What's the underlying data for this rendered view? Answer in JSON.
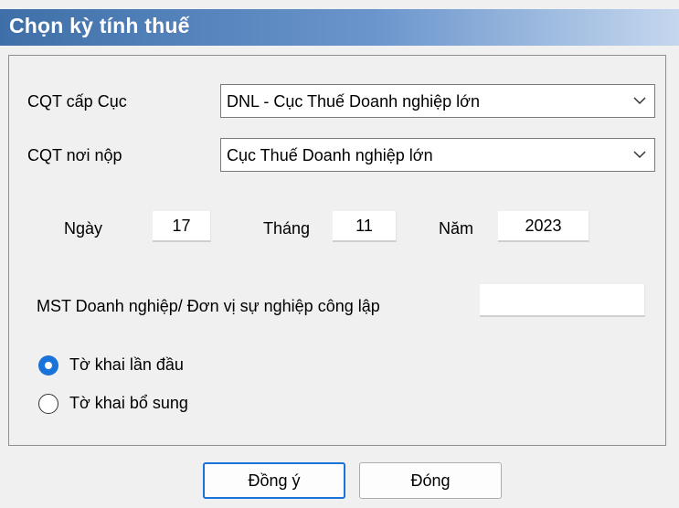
{
  "window": {
    "title": "Chọn kỳ tính thuế"
  },
  "form": {
    "cqt_cap_cuc": {
      "label": "CQT cấp Cục",
      "value": "DNL - Cục Thuế Doanh nghiệp lớn"
    },
    "cqt_noi_nop": {
      "label": "CQT nơi nộp",
      "value": "Cục Thuế Doanh nghiệp lớn"
    },
    "date": {
      "day_label": "Ngày",
      "day": "17",
      "month_label": "Tháng",
      "month": "11",
      "year_label": "Năm",
      "year": "2023"
    },
    "mst": {
      "label": "MST Doanh nghiệp/ Đơn vị sự nghiệp công lập",
      "value": ""
    },
    "declaration_type": {
      "options": [
        "Tờ khai lần đầu",
        "Tờ khai bổ sung"
      ],
      "selected": "Tờ khai lần đầu"
    }
  },
  "buttons": {
    "ok": "Đồng ý",
    "close": "Đóng"
  }
}
